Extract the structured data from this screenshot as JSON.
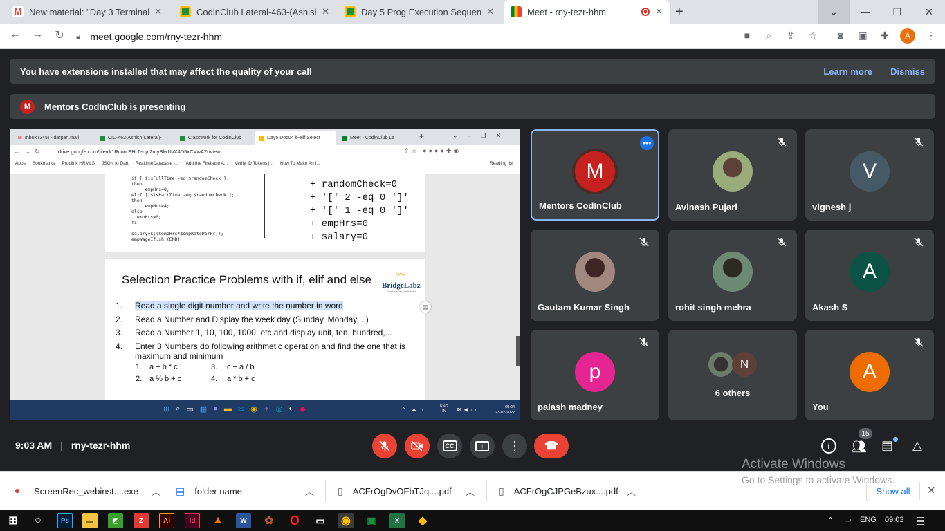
{
  "browser": {
    "tabs": [
      {
        "title": "New material: \"Day 3 Terminal Cr",
        "icon": "gmail-icon"
      },
      {
        "title": "CodinClub Lateral-463-(Ashish)-F",
        "icon": "classroom-icon"
      },
      {
        "title": "Day 5 Prog Execution Sequences",
        "icon": "classroom-icon"
      },
      {
        "title": "Meet - rny-tezr-hhm",
        "icon": "meet-icon"
      }
    ],
    "url": "meet.google.com/rny-tezr-hhm",
    "profile_initial": "A"
  },
  "banner": {
    "text": "You have extensions installed that may affect the quality of your call",
    "learn_more": "Learn more",
    "dismiss": "Dismiss"
  },
  "presenting": {
    "initial": "M",
    "text": "Mentors CodInClub is presenting"
  },
  "shared": {
    "tabs": [
      "Inbox (345) - darpan.mail",
      "CIC-463-Ashish(Lateral)-",
      "Classwork for CodinClub",
      "Day5 Doc04 if-elif Select",
      "Meet - CodinClub La"
    ],
    "url": "drive.google.com/file/d/1RconrEHc0-dpl2myBlwUvX4D5xCVwA7r/view",
    "bookmarks": [
      "Apps",
      "Bookmarks",
      "Proclink HRMLS",
      "JSON to Dart",
      "RealtimeDatabase -...",
      "Add the Firebase A...",
      "Verify ID Tokens |...",
      "How To Make An I...",
      "Reading list"
    ],
    "code_left": "if [ $isFullTime -eq $randomCheck ];\nthen\n     empHrs=8;\nelif [ $isPartTime -eq $randomCheck ];\nthen\n     empHrs=4;\nelse\n  empHrs=0;\nfi\n\nsalary=$(($empHrs*$empRatePerHr));\nempWageIf.sh (END)",
    "code_right": "+ randomCheck=0\n+ '[' 2 -eq 0 ']'\n+ '[' 1 -eq 0 ']'\n+ empHrs=0\n+ salary=0",
    "slide_title": "Selection Practice Problems with if, elif and else",
    "logo": "BridgeLabz",
    "logo_tag": "Employability Delivered",
    "items": [
      {
        "n": "1.",
        "text": "Read a single digit number and write the number in word"
      },
      {
        "n": "2.",
        "text": "Read a Number and Display the week day (Sunday, Monday,...)"
      },
      {
        "n": "3.",
        "text": "Read a Number 1, 10, 100, 1000, etc and display unit, ten, hundred,..."
      },
      {
        "n": "4.",
        "text": "Enter 3 Numbers do following arithmetic operation and find the one that is maximum and minimum"
      }
    ],
    "sub_items": [
      {
        "n": "1.",
        "text": "a + b * c"
      },
      {
        "n": "3.",
        "text": "c + a / b"
      },
      {
        "n": "2.",
        "text": "a % b + c"
      },
      {
        "n": "4.",
        "text": "a * b + c"
      }
    ],
    "taskbar_time": "09:04",
    "taskbar_date": "23-02-2022",
    "taskbar_lang": "ENG",
    "taskbar_region": "IN"
  },
  "participants": [
    {
      "name": "Mentors CodInClub",
      "initial": "M",
      "color": "#c5221f"
    },
    {
      "name": "Avinash Pujari",
      "initial": "",
      "color": "#8c9a6e"
    },
    {
      "name": "vignesh j",
      "initial": "V",
      "color": "#455a64"
    },
    {
      "name": "Gautam Kumar Singh",
      "initial": "",
      "color": "#7a6d62"
    },
    {
      "name": "rohit singh mehra",
      "initial": "",
      "color": "#4e6b58"
    },
    {
      "name": "Akash S",
      "initial": "A",
      "color": "#0b5345"
    },
    {
      "name": "palash madney",
      "initial": "p",
      "color": "#e52592"
    },
    {
      "name": "6 others",
      "initial": "N",
      "color": "#5d4037"
    },
    {
      "name": "You",
      "initial": "A",
      "color": "#ef6c00"
    }
  ],
  "bottom": {
    "time": "9:03 AM",
    "meeting_code": "rny-tezr-hhm",
    "people_count": "15"
  },
  "watermark": {
    "line1": "Activate Windows",
    "line2": "Go to Settings to activate Windows."
  },
  "downloads": [
    {
      "name": "ScreenRec_webinst....exe",
      "icon": "exe-icon"
    },
    {
      "name": "folder name",
      "icon": "file-icon"
    },
    {
      "name": "ACFrOgDvOFbTJq....pdf",
      "icon": "pdf-icon"
    },
    {
      "name": "ACFrOgCJPGeBzux....pdf",
      "icon": "pdf-icon"
    }
  ],
  "downloads_show_all": "Show all",
  "windows": {
    "lang": "ENG",
    "time": "09:03"
  }
}
